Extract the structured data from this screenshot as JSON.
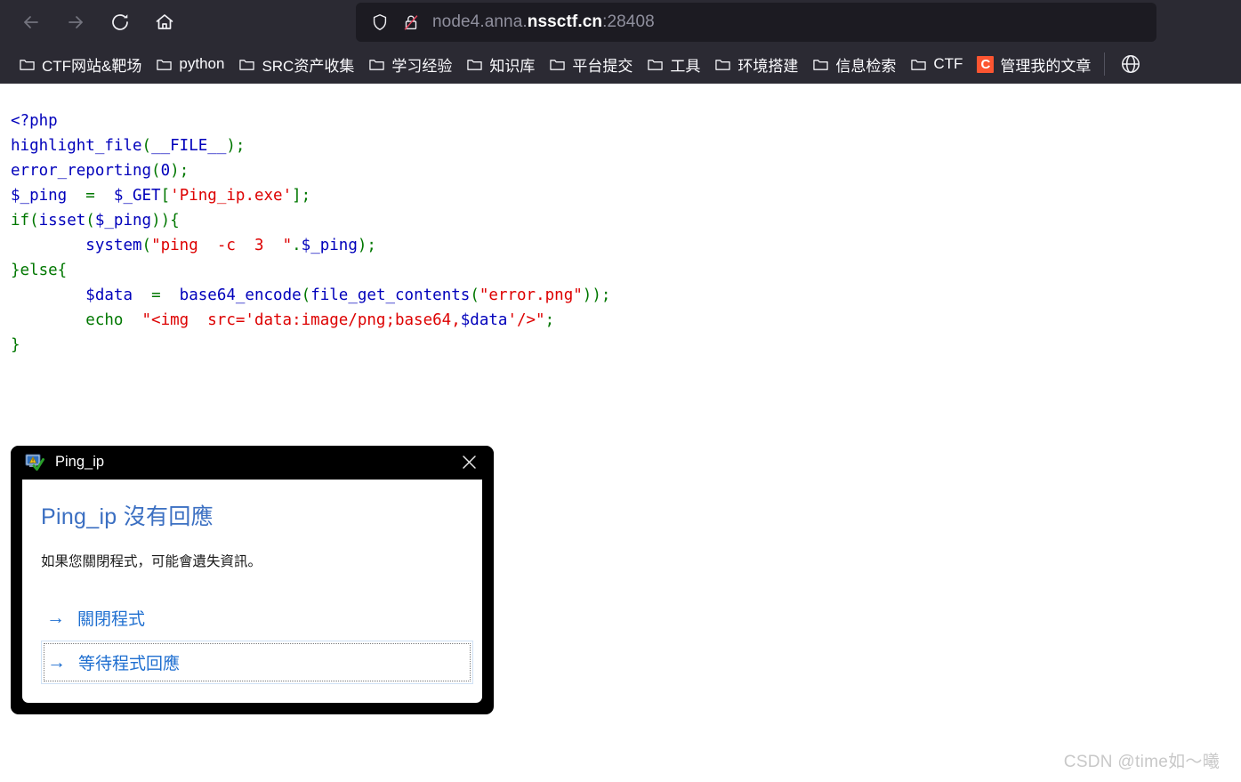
{
  "browser": {
    "nav": {
      "back_label": "Back",
      "forward_label": "Forward",
      "reload_label": "Reload",
      "home_label": "Home"
    },
    "url_bar": {
      "shield_icon": "shield-icon",
      "lock_icon": "lock-crossed-icon",
      "url_prefix": "node4.anna.",
      "url_host": "nssctf.cn",
      "url_suffix": ":28408",
      "full_url": "node4.anna.nssctf.cn:28408"
    },
    "bookmarks": [
      {
        "label": "CTF网站&靶场",
        "icon": "folder-icon"
      },
      {
        "label": "python",
        "icon": "folder-icon"
      },
      {
        "label": "SRC资产收集",
        "icon": "folder-icon"
      },
      {
        "label": "学习经验",
        "icon": "folder-icon"
      },
      {
        "label": "知识库",
        "icon": "folder-icon"
      },
      {
        "label": "平台提交",
        "icon": "folder-icon"
      },
      {
        "label": "工具",
        "icon": "folder-icon"
      },
      {
        "label": "环境搭建",
        "icon": "folder-icon"
      },
      {
        "label": "信息检索",
        "icon": "folder-icon"
      },
      {
        "label": "CTF",
        "icon": "folder-icon"
      },
      {
        "label": "管理我的文章",
        "icon": "csdn-icon",
        "icon_text": "C"
      }
    ],
    "overflow_icon": "globe-icon",
    "colors": {
      "chrome_bg": "#2b2a33",
      "urlbar_bg": "#1c1b22",
      "csdn_orange": "#fc5531"
    }
  },
  "page_source": {
    "lines": [
      "<?php",
      "highlight_file(__FILE__);",
      "error_reporting(0);",
      "$_ping  =  $_GET['Ping_ip.exe'];",
      "if(isset($_ping)){",
      "        system(\"ping  -c  3  \".$_ping);",
      "}else{",
      "        $data  =  base64_encode(file_get_contents(\"error.png\"));",
      "        echo  \"<img  src='data:image/png;base64,$data'/>\";",
      "}"
    ],
    "tokens": {
      "php_open": "<?php",
      "fn_highlight_file": "highlight_file",
      "const_file": "__FILE__",
      "fn_error_reporting": "error_reporting",
      "num_zero": "0",
      "var_ping": "$_ping",
      "superglobal_get": "$_GET",
      "str_param": "'Ping_ip.exe'",
      "kw_if": "if",
      "fn_isset": "isset",
      "fn_system": "system",
      "str_ping_cmd": "\"ping  -c  3  \"",
      "kw_else": "}else{",
      "var_data": "$data",
      "fn_base64": "base64_encode",
      "fn_file_get_contents": "file_get_contents",
      "str_errorpng": "\"error.png\"",
      "kw_echo": "echo",
      "str_img": "\"<img  src='data:image/png;base64,$data'/>\""
    },
    "colors": {
      "keyword_blue": "#0000bb",
      "syntax_green": "#007700",
      "string_red": "#dd0000"
    }
  },
  "dialog": {
    "app_icon": "program-warning-icon",
    "title": "Ping_ip",
    "close_icon": "close-icon",
    "heading": "Ping_ip 沒有回應",
    "body_text": "如果您關閉程式，可能會遺失資訊。",
    "actions": [
      {
        "label": "關閉程式",
        "arrow": "→",
        "focused": false
      },
      {
        "label": "等待程式回應",
        "arrow": "→",
        "focused": true
      }
    ],
    "colors": {
      "heading_blue": "#3B6FC2",
      "link_blue": "#1f6fd0",
      "frame_black": "#000000"
    }
  },
  "watermark": {
    "text": "CSDN @time如～曦"
  }
}
